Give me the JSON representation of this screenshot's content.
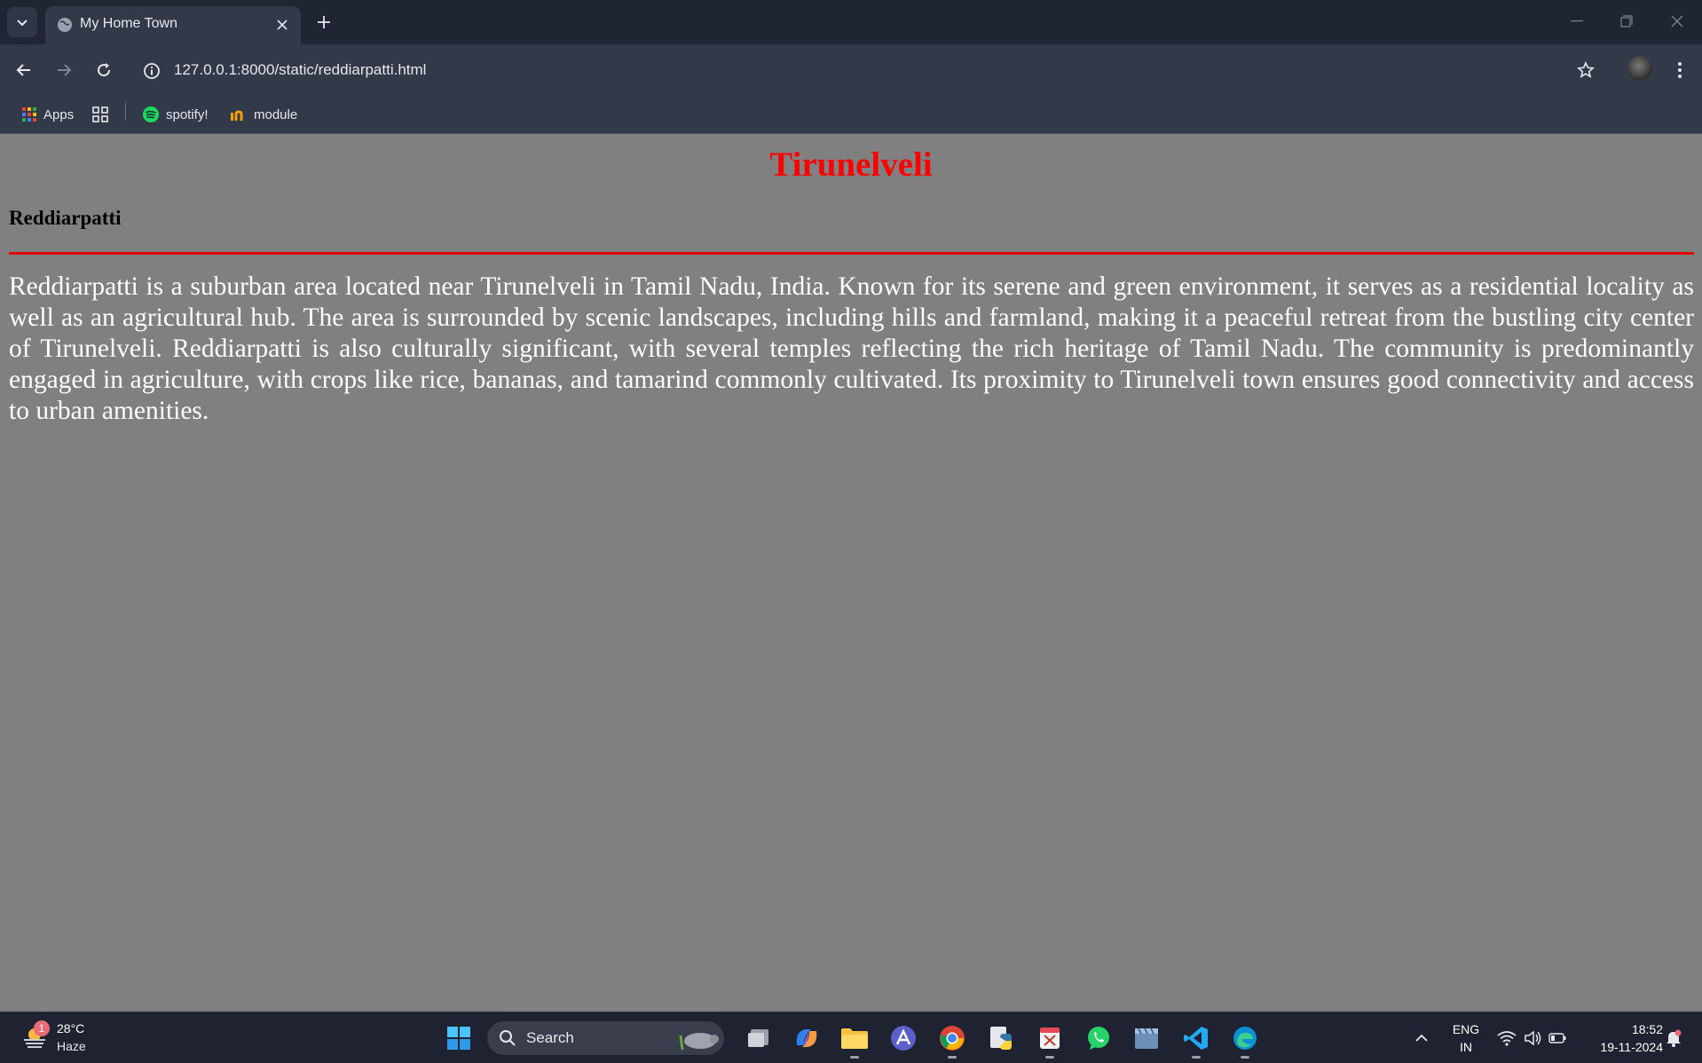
{
  "browser": {
    "tab_title": "My Home Town",
    "url": "127.0.0.1:8000/static/reddiarpatti.html",
    "bookmarks": [
      {
        "label": "Apps",
        "icon": "apps-grid-icon"
      },
      {
        "label": "",
        "icon": "tab-groups-icon"
      },
      {
        "label": "spotify!",
        "icon": "spotify-icon"
      },
      {
        "label": "module",
        "icon": "module-icon"
      }
    ]
  },
  "page": {
    "title": "Tirunelveli",
    "section_title": "Reddiarpatti",
    "body": "Reddiarpatti is a suburban area located near Tirunelveli in Tamil Nadu, India. Known for its serene and green environment, it serves as a residential locality as well as an agricultural hub. The area is surrounded by scenic landscapes, including hills and farmland, making it a peaceful retreat from the bustling city center of Tirunelveli. Reddiarpatti is also culturally significant, with several temples reflecting the rich heritage of Tamil Nadu. The community is predominantly engaged in agriculture, with crops like rice, bananas, and tamarind commonly cultivated. Its proximity to Tirunelveli town ensures good connectivity and access to urban amenities.",
    "colors": {
      "background": "#808080",
      "title": "#ff0000",
      "divider": "#e00000",
      "body_text": "#ffffff"
    }
  },
  "taskbar": {
    "weather": {
      "badge": "1",
      "temp": "28°C",
      "condition": "Haze"
    },
    "search_label": "Search",
    "language": "ENG",
    "region": "IN",
    "time": "18:52",
    "date": "19-11-2024"
  }
}
